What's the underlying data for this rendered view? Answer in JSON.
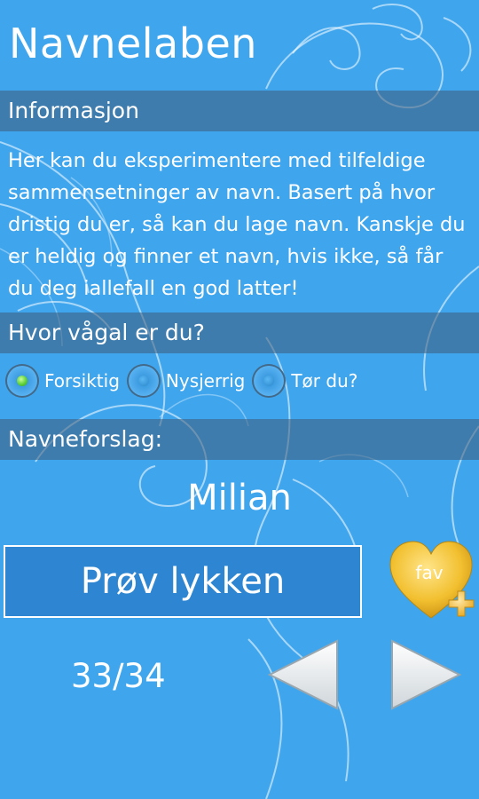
{
  "app": {
    "title": "Navnelaben"
  },
  "info": {
    "heading": "Informasjon",
    "text": "Her kan du eksperimentere med tilfeldige sammensetninger av navn. Basert på hvor dristig du er, så kan du lage navn. Kanskje du er heldig og finner et navn, hvis ikke, så får du deg iallefall en god latter!"
  },
  "boldness": {
    "heading": "Hvor vågal er du?",
    "options": [
      {
        "label": "Forsiktig",
        "selected": true
      },
      {
        "label": "Nysjerrig",
        "selected": false
      },
      {
        "label": "Tør du?",
        "selected": false
      }
    ]
  },
  "suggestion": {
    "heading": "Navneforslag:",
    "name": "Milian"
  },
  "actions": {
    "try_label": "Prøv lykken",
    "fav_label": "fav"
  },
  "pager": {
    "counter": "33/34"
  },
  "icons": {
    "fav": "heart-fav-icon",
    "prev": "triangle-left-icon",
    "next": "triangle-right-icon"
  },
  "colors": {
    "background": "#3fa6ee",
    "bar": "#4a7394",
    "button": "#2e86d2",
    "heart": "#f2c030",
    "radio_selected": "#5fd03a"
  }
}
